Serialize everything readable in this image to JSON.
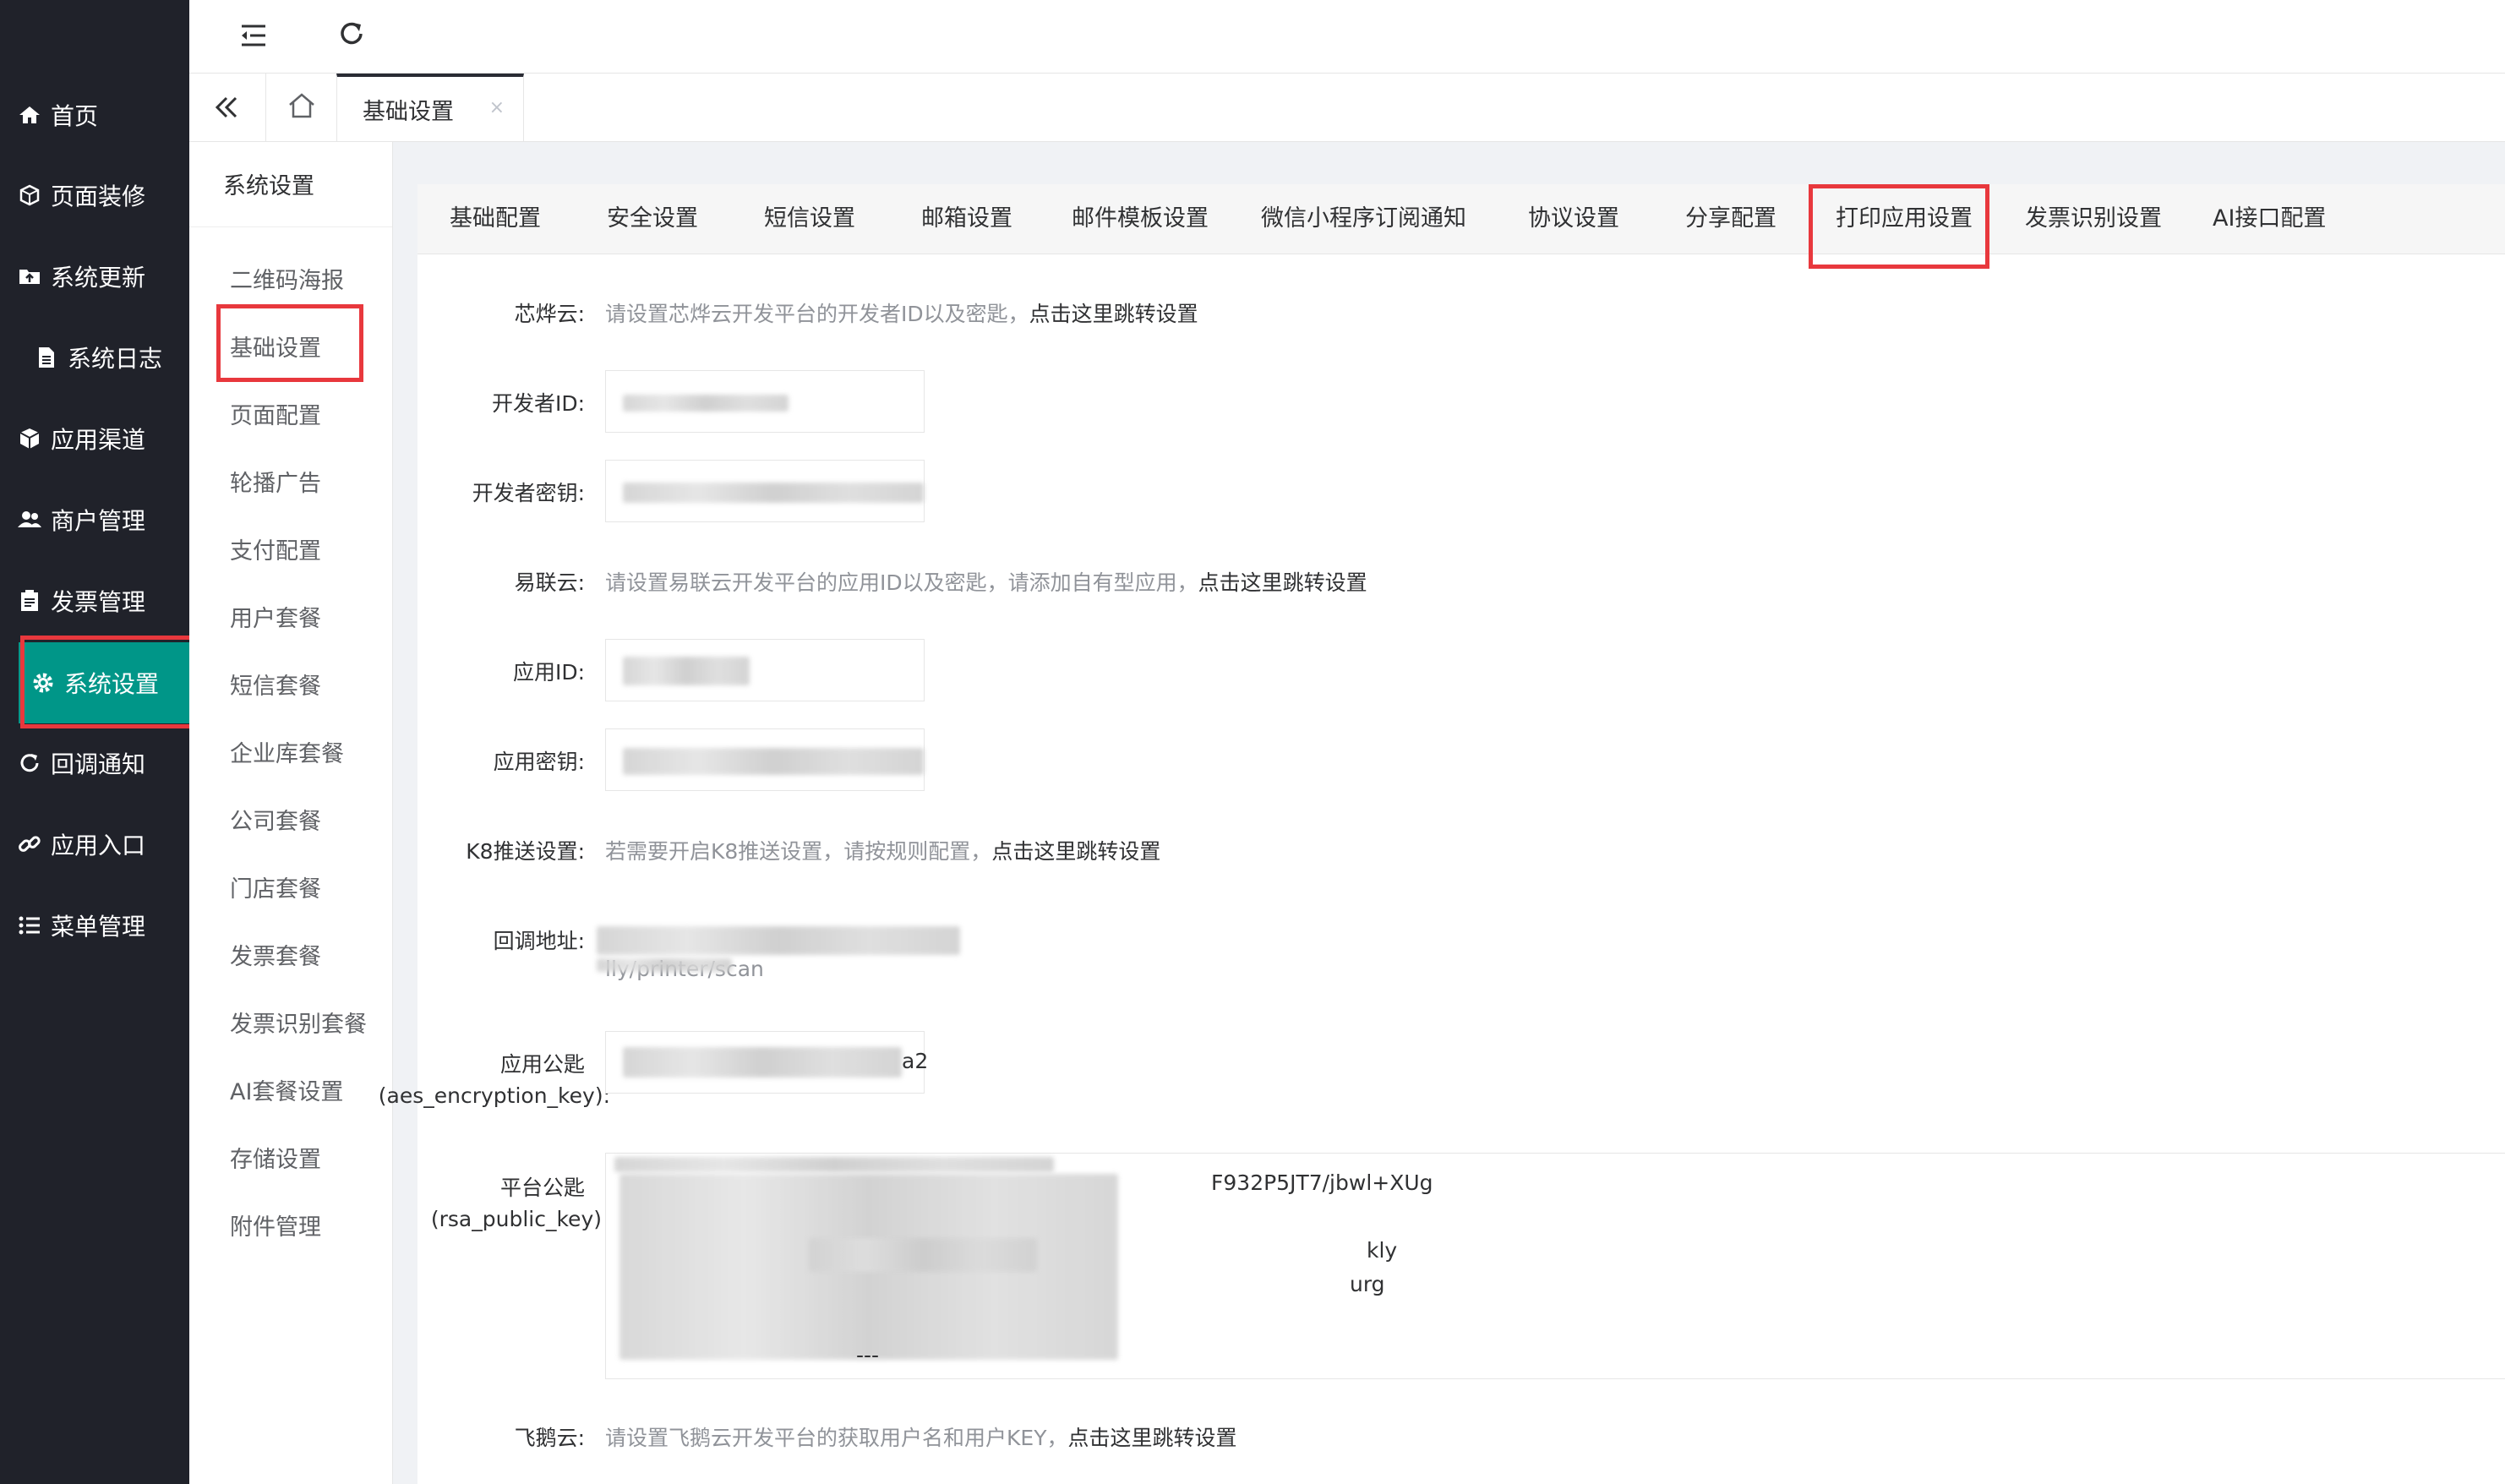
{
  "sidebar": {
    "items": [
      {
        "label": "首页",
        "icon": "home-icon"
      },
      {
        "label": "页面装修",
        "icon": "cube-icon"
      },
      {
        "label": "系统更新",
        "icon": "folder-icon"
      },
      {
        "label": "系统日志",
        "icon": "document-icon"
      },
      {
        "label": "应用渠道",
        "icon": "box-icon"
      },
      {
        "label": "商户管理",
        "icon": "users-icon"
      },
      {
        "label": "发票管理",
        "icon": "clipboard-icon"
      },
      {
        "label": "系统设置",
        "icon": "gear-icon"
      },
      {
        "label": "回调通知",
        "icon": "refresh-icon"
      },
      {
        "label": "应用入口",
        "icon": "link-icon"
      },
      {
        "label": "菜单管理",
        "icon": "list-icon"
      }
    ],
    "active_color": "#009688"
  },
  "tabbar": {
    "current_tab": "基础设置",
    "close_glyph": "×"
  },
  "submenu": {
    "title": "系统设置",
    "items": [
      "二维码海报",
      "基础设置",
      "页面配置",
      "轮播广告",
      "支付配置",
      "用户套餐",
      "短信套餐",
      "企业库套餐",
      "公司套餐",
      "门店套餐",
      "发票套餐",
      "发票识别套餐",
      "AI套餐设置",
      "存储设置",
      "附件管理"
    ]
  },
  "tabs": [
    "基础配置",
    "安全设置",
    "短信设置",
    "邮箱设置",
    "邮件模板设置",
    "微信小程序订阅通知",
    "协议设置",
    "分享配置",
    "打印应用设置",
    "发票识别设置",
    "AI接口配置"
  ],
  "form": {
    "xinye": {
      "label": "芯烨云:",
      "hint": "请设置芯烨云开发平台的开发者ID以及密匙，",
      "link": "点击这里跳转设置"
    },
    "dev_id": {
      "label": "开发者ID:"
    },
    "dev_key": {
      "label": "开发者密钥:"
    },
    "yilian": {
      "label": "易联云:",
      "hint": "请设置易联云开发平台的应用ID以及密匙，请添加自有型应用，",
      "link": "点击这里跳转设置"
    },
    "app_id": {
      "label": "应用ID:"
    },
    "app_key": {
      "label": "应用密钥:"
    },
    "k8": {
      "label": "K8推送设置:",
      "hint": "若需要开启K8推送设置，请按规则配置，",
      "link": "点击这里跳转设置"
    },
    "callback": {
      "label": "回调地址:",
      "tail": "lly/printer/scan"
    },
    "app_pubkey": {
      "label": "应用公匙",
      "label2": "(aes_encryption_key):",
      "tail": "a2"
    },
    "platform_pubkey": {
      "label": "平台公匙",
      "label2": "(rsa_public_key)",
      "line1_tail": "F932P5JT7/jbwl+XUg",
      "line3_tail": "kly",
      "line4_tail": "urg",
      "line6_tail": "---"
    },
    "feie": {
      "label": "飞鹅云:",
      "hint": "请设置飞鹅云开发平台的获取用户名和用户KEY，",
      "link": "点击这里跳转设置"
    }
  },
  "highlight_color": "#e8383d"
}
